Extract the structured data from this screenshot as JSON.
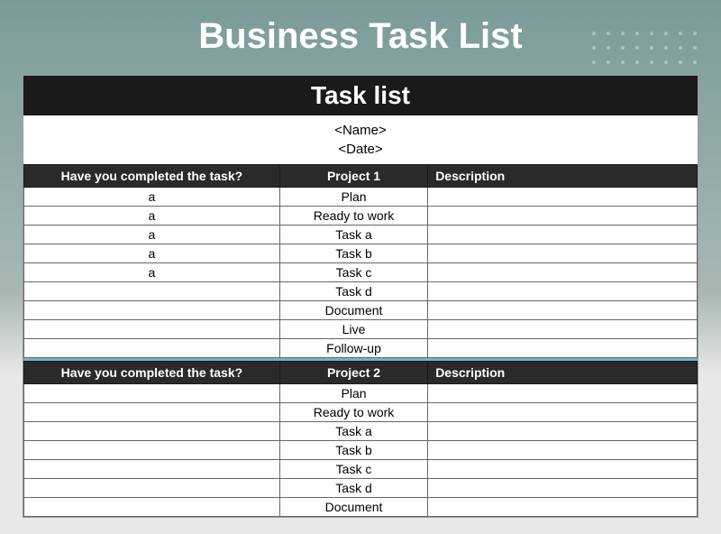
{
  "page_title": "Business Task List",
  "sheet_title": "Task list",
  "meta": {
    "name": "<Name>",
    "date": "<Date>"
  },
  "columns": {
    "completed": "Have you completed the task?",
    "description": "Description"
  },
  "projects": [
    {
      "header": "Project 1",
      "rows": [
        {
          "completed": "a",
          "task": "Plan",
          "description": ""
        },
        {
          "completed": "a",
          "task": "Ready to work",
          "description": ""
        },
        {
          "completed": "a",
          "task": "Task a",
          "description": ""
        },
        {
          "completed": "a",
          "task": "Task b",
          "description": ""
        },
        {
          "completed": "a",
          "task": "Task c",
          "description": ""
        },
        {
          "completed": "",
          "task": "Task d",
          "description": ""
        },
        {
          "completed": "",
          "task": "Document",
          "description": ""
        },
        {
          "completed": "",
          "task": "Live",
          "description": ""
        },
        {
          "completed": "",
          "task": "Follow-up",
          "description": ""
        }
      ]
    },
    {
      "header": "Project 2",
      "rows": [
        {
          "completed": "",
          "task": "Plan",
          "description": ""
        },
        {
          "completed": "",
          "task": "Ready to work",
          "description": ""
        },
        {
          "completed": "",
          "task": "Task a",
          "description": ""
        },
        {
          "completed": "",
          "task": "Task b",
          "description": ""
        },
        {
          "completed": "",
          "task": "Task c",
          "description": ""
        },
        {
          "completed": "",
          "task": "Task d",
          "description": ""
        },
        {
          "completed": "",
          "task": "Document",
          "description": ""
        }
      ]
    }
  ]
}
